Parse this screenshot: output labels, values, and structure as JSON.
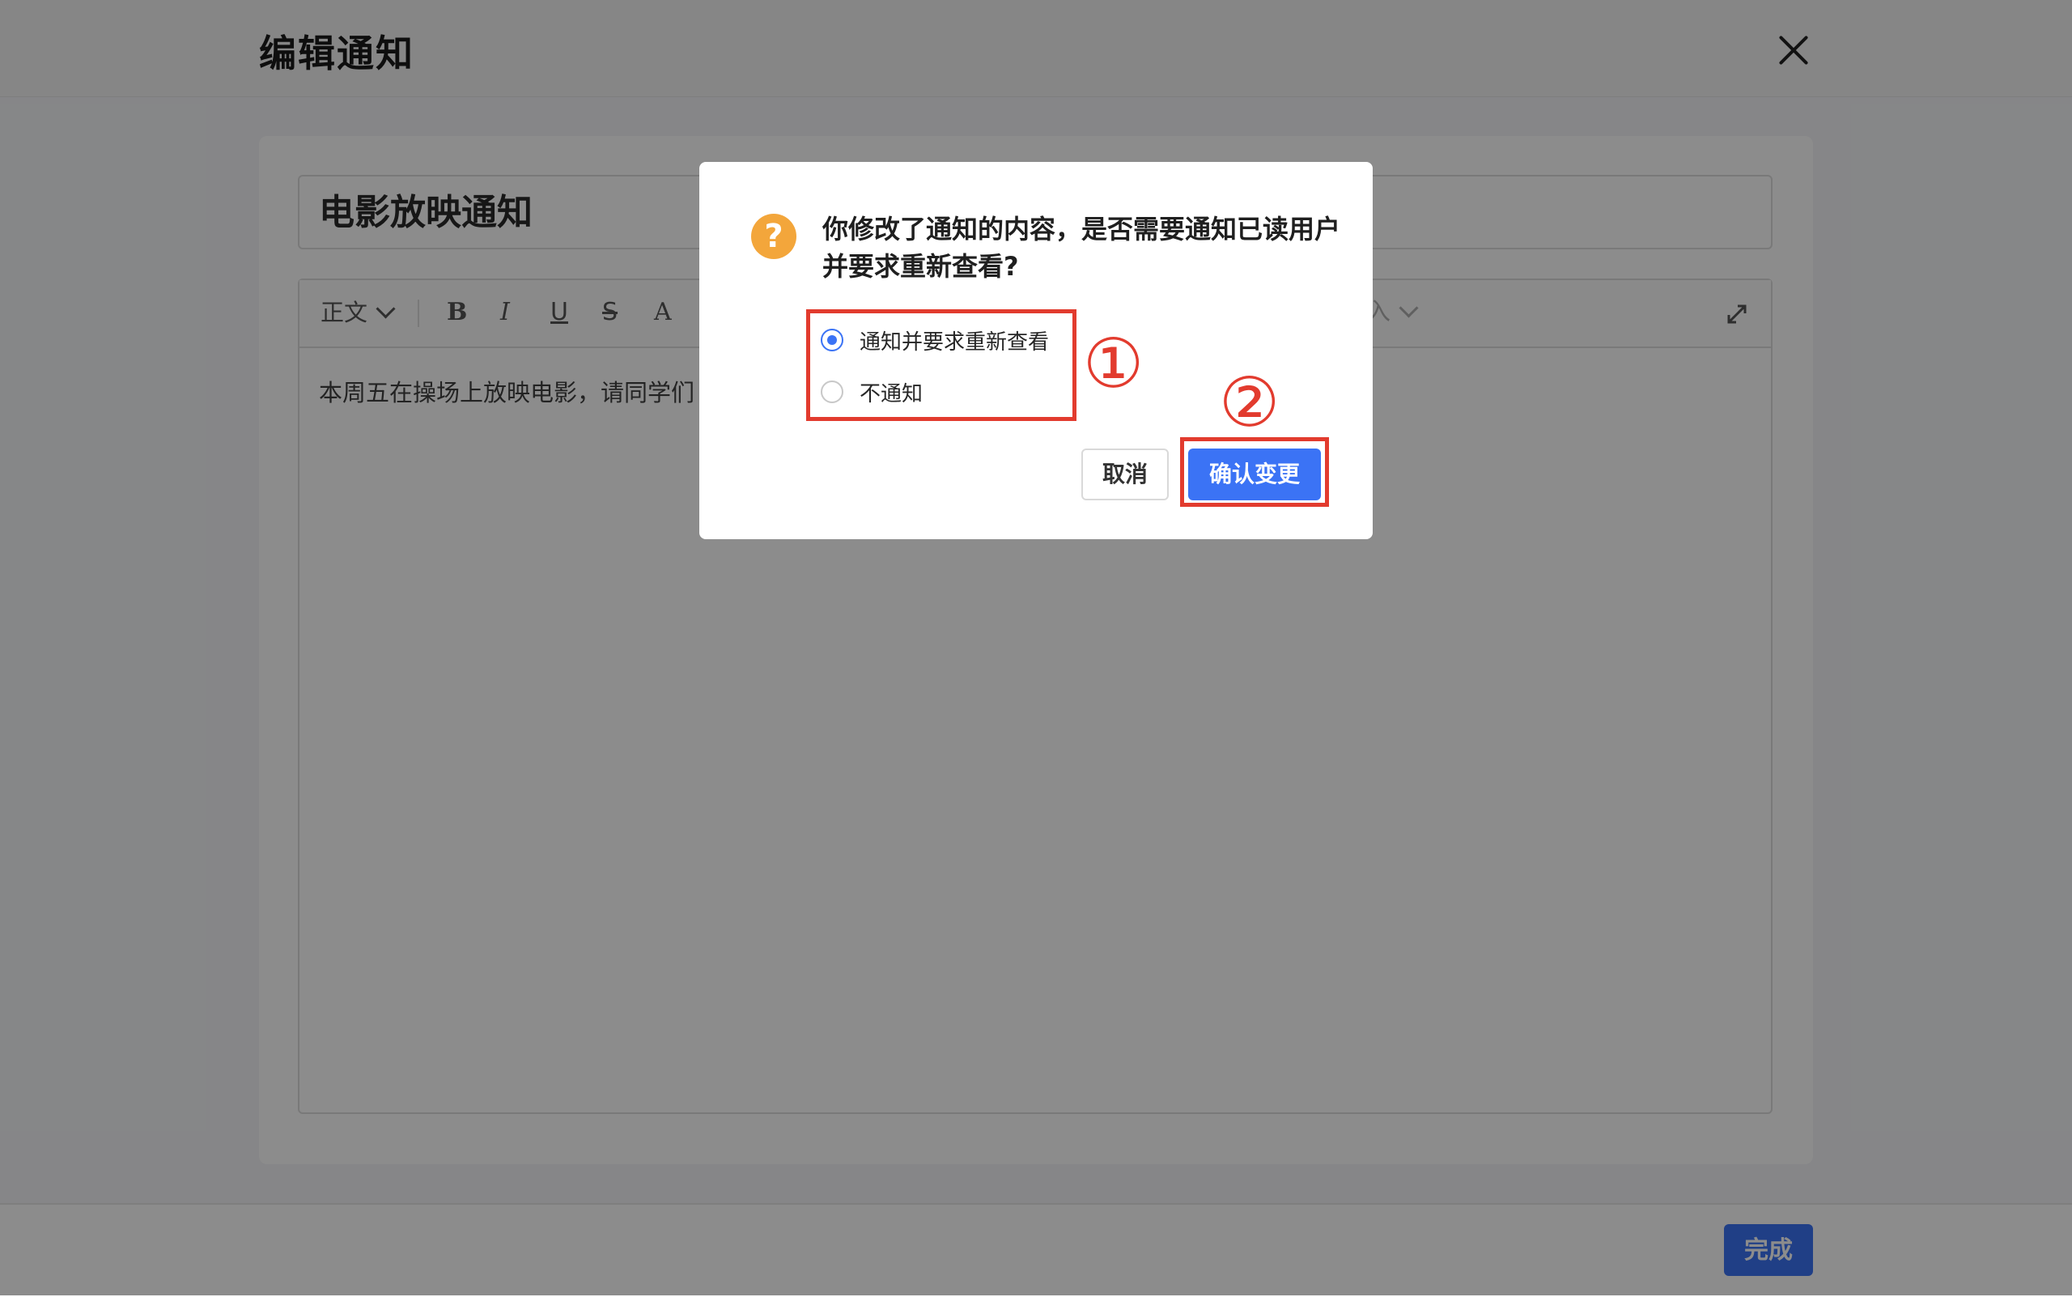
{
  "header": {
    "title": "编辑通知",
    "close_icon": "close-icon"
  },
  "notice": {
    "title": "电影放映通知",
    "body_visible": "本周五在操场上放映电影，请同学们"
  },
  "toolbar": {
    "style_label": "正文",
    "bold": "B",
    "italic": "I",
    "underline": "U",
    "strikethrough": "S",
    "font_color": "A",
    "insert_label": "入",
    "expand_icon": "expand-icon"
  },
  "footer": {
    "done_label": "完成"
  },
  "modal": {
    "icon": "question-icon",
    "icon_color": "#f3a63b",
    "message": "你修改了通知的内容，是否需要通知已读用户并要求重新查看?",
    "options": [
      {
        "label": "通知并要求重新查看",
        "selected": true
      },
      {
        "label": "不通知",
        "selected": false
      }
    ],
    "cancel_label": "取消",
    "confirm_label": "确认变更",
    "accent_color": "#3b73f5"
  },
  "annotations": {
    "step1": "①",
    "step2": "②",
    "color": "#e23b2e"
  }
}
